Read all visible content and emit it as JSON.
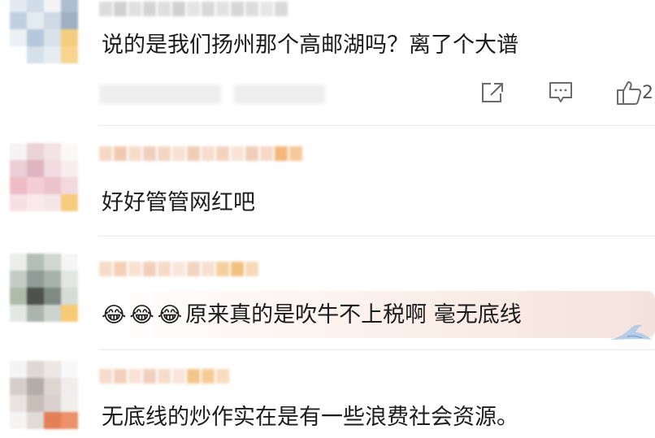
{
  "comments": [
    {
      "text": "说的是我们扬州那个高邮湖吗？离了个大谱",
      "like_count": "2"
    },
    {
      "text": "好好管管网红吧"
    },
    {
      "emojis": [
        "😂",
        "😂",
        "😂"
      ],
      "text": "原来真的是吹牛不上税啊 毫无底线"
    },
    {
      "text": "无底线的炒作实在是有一些浪费社会资源。"
    }
  ],
  "icons": {
    "share": "share-icon",
    "reply": "comment-icon",
    "like": "thumbs-up-icon"
  },
  "colors": {
    "text": "#1c1c1c",
    "divider": "#e9e9e9",
    "icon": "#6b6b6b",
    "badge": "#f4b45a"
  }
}
